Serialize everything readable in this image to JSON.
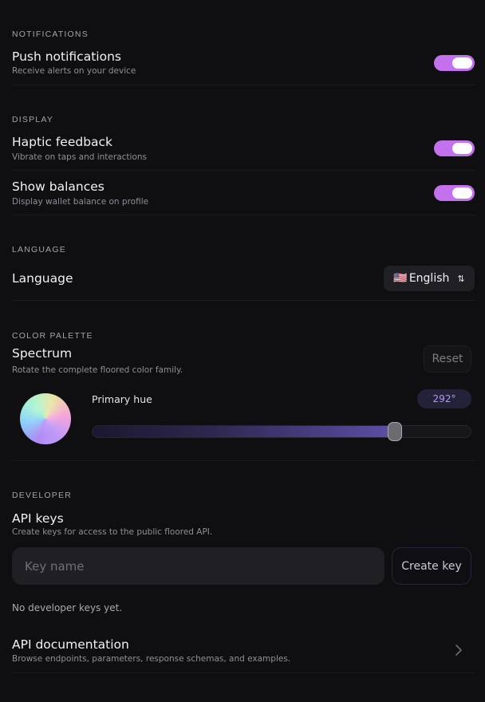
{
  "notifications": {
    "section_label": "NOTIFICATIONS",
    "push": {
      "title": "Push notifications",
      "subtitle": "Receive alerts on your device",
      "enabled": true
    }
  },
  "display": {
    "section_label": "DISPLAY",
    "haptic": {
      "title": "Haptic feedback",
      "subtitle": "Vibrate on taps and interactions",
      "enabled": true
    },
    "balances": {
      "title": "Show balances",
      "subtitle": "Display wallet balance on profile",
      "enabled": true
    }
  },
  "language": {
    "section_label": "LANGUAGE",
    "title": "Language",
    "selected": "English",
    "flag": "🇺🇸",
    "arrows": "⇅"
  },
  "palette": {
    "section_label": "COLOR PALETTE",
    "title": "Spectrum",
    "subtitle": "Rotate the complete floored color family.",
    "reset_label": "Reset",
    "hue_label": "Primary hue",
    "hue_value": "292°",
    "hue_fraction": 0.811
  },
  "developer": {
    "section_label": "DEVELOPER",
    "title": "API keys",
    "subtitle": "Create keys for access to the public floored API.",
    "input_placeholder": "Key name",
    "create_label": "Create key",
    "empty_note": "No developer keys yet.",
    "docs": {
      "title": "API documentation",
      "subtitle": "Browse endpoints, parameters, response schemas, and examples."
    }
  },
  "colors": {
    "accent": "#c471ed",
    "hue_text": "#b197fc",
    "background": "#0f0f11"
  },
  "icons": {
    "language_arrows": "swap-arrows-icon",
    "docs": "chevron-right-icon"
  }
}
